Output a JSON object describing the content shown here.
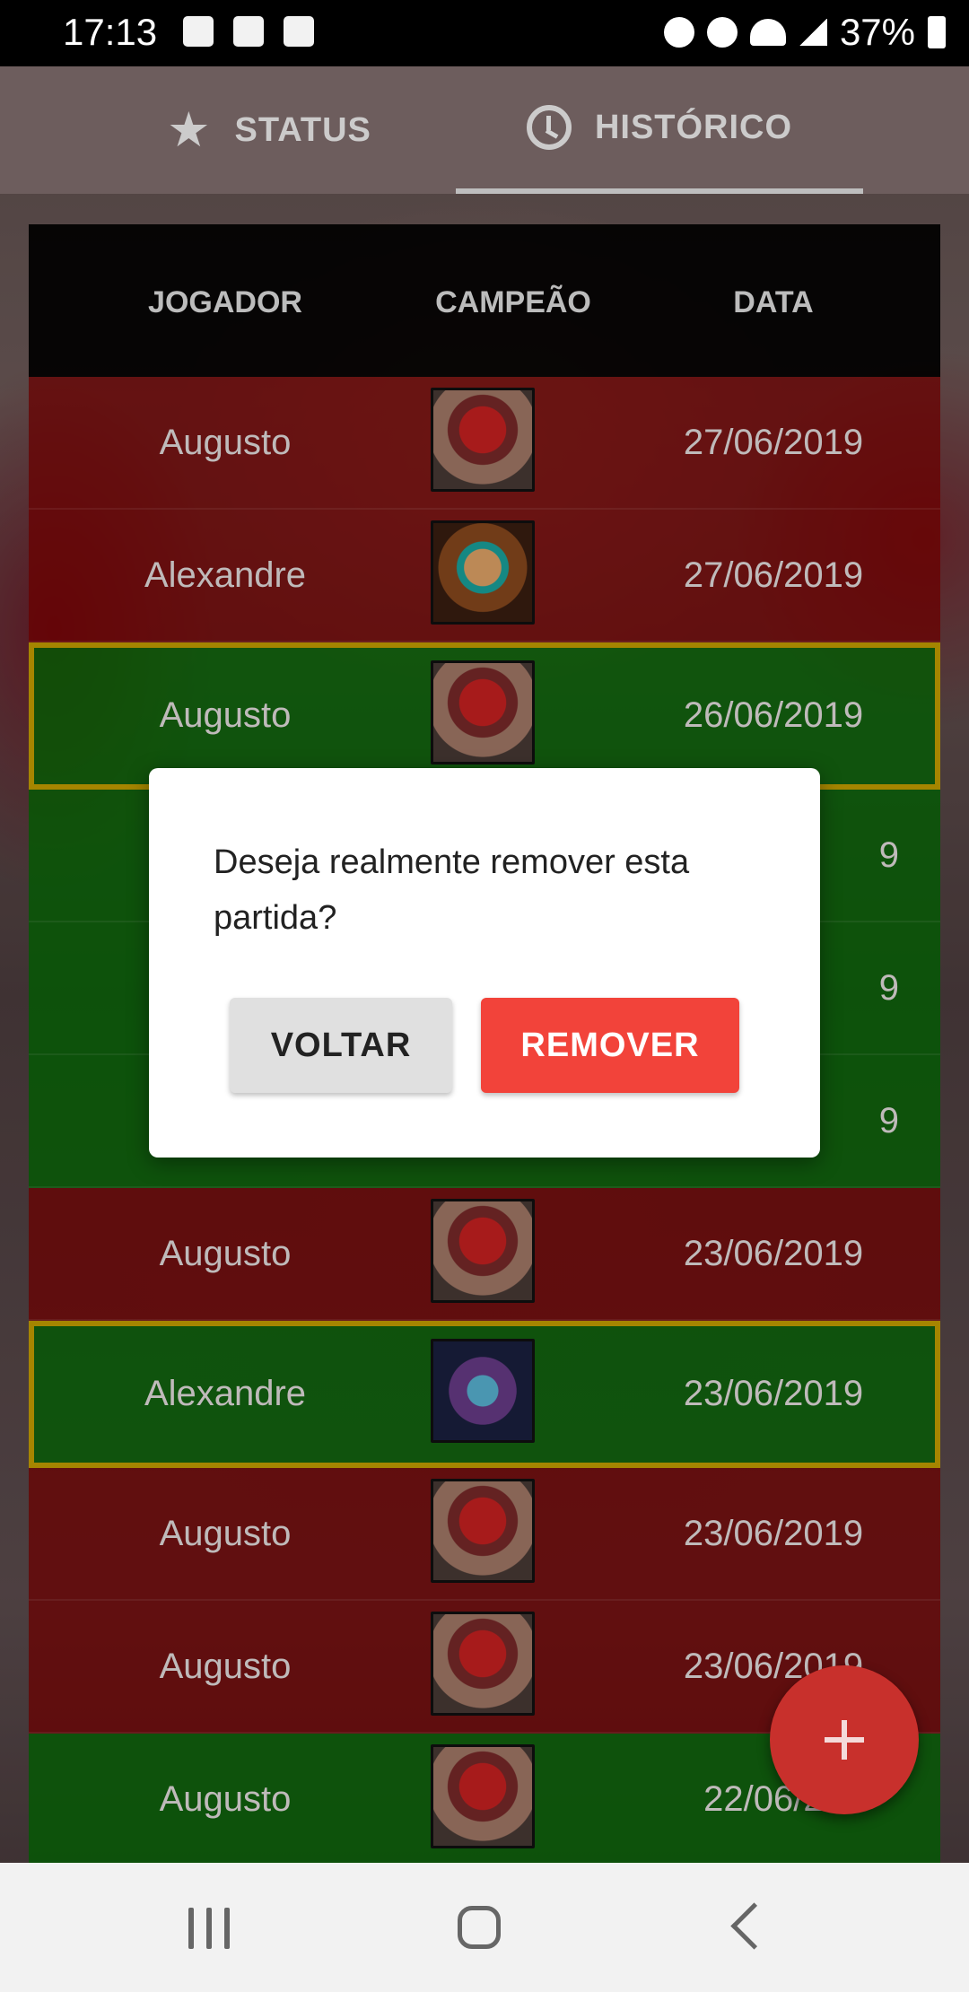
{
  "status_bar": {
    "time": "17:13",
    "battery": "37%"
  },
  "tabs": [
    {
      "label": "STATUS",
      "icon": "star-icon",
      "selected": false
    },
    {
      "label": "HISTÓRICO",
      "icon": "clock-icon",
      "selected": true
    }
  ],
  "table": {
    "headers": {
      "player": "JOGADOR",
      "champion": "CAMPEÃO",
      "date": "DATA"
    },
    "rows": [
      {
        "player": "Augusto",
        "champion_icon": "lee-sin-portrait",
        "date": "27/06/2019",
        "result": "loss"
      },
      {
        "player": "Alexandre",
        "champion_icon": "sivir-portrait",
        "date": "27/06/2019",
        "result": "loss"
      },
      {
        "player": "Augusto",
        "champion_icon": "lee-sin-portrait",
        "date": "26/06/2019",
        "result": "win",
        "highlighted": true
      },
      {
        "player": "",
        "champion_icon": "",
        "date": "9",
        "result": "win"
      },
      {
        "player": "",
        "champion_icon": "",
        "date": "9",
        "result": "win"
      },
      {
        "player": "",
        "champion_icon": "",
        "date": "9",
        "result": "win"
      },
      {
        "player": "Augusto",
        "champion_icon": "lee-sin-portrait",
        "date": "23/06/2019",
        "result": "loss"
      },
      {
        "player": "Alexandre",
        "champion_icon": "caitlyn-portrait",
        "date": "23/06/2019",
        "result": "win",
        "highlighted": true
      },
      {
        "player": "Augusto",
        "champion_icon": "lee-sin-portrait",
        "date": "23/06/2019",
        "result": "loss"
      },
      {
        "player": "Augusto",
        "champion_icon": "lee-sin-portrait",
        "date": "23/06/2019",
        "result": "loss"
      },
      {
        "player": "Augusto",
        "champion_icon": "lee-sin-portrait",
        "date": "22/06/20",
        "result": "win"
      }
    ]
  },
  "dialog": {
    "message": "Deseja realmente remover esta partida?",
    "cancel_label": "VOLTAR",
    "confirm_label": "REMOVER"
  },
  "fab": {
    "icon": "plus-icon"
  },
  "colors": {
    "loss_row": "#800000",
    "win_row": "#006e00",
    "highlight_border": "#caa300",
    "remove_button": "#f2433a",
    "fab": "#c8302c"
  }
}
